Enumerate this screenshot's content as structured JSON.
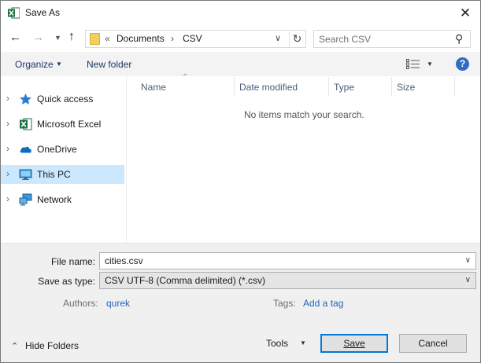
{
  "window": {
    "title": "Save As",
    "app_icon": "excel-icon"
  },
  "address": {
    "folder_icon": "folder-icon",
    "overflow": "«",
    "crumbs": [
      "Documents",
      "CSV"
    ],
    "separator": "›"
  },
  "search": {
    "placeholder": "Search CSV"
  },
  "toolbar": {
    "organize": "Organize",
    "new_folder": "New folder",
    "help": "?"
  },
  "nav": {
    "items": [
      {
        "label": "Quick access",
        "icon": "star-icon"
      },
      {
        "label": "Microsoft Excel",
        "icon": "excel-icon"
      },
      {
        "label": "OneDrive",
        "icon": "cloud-icon"
      },
      {
        "label": "This PC",
        "icon": "computer-icon",
        "selected": true
      },
      {
        "label": "Network",
        "icon": "network-icon"
      }
    ]
  },
  "filelist": {
    "columns": [
      "Name",
      "Date modified",
      "Type",
      "Size"
    ],
    "empty_message": "No items match your search."
  },
  "form": {
    "file_name_label": "File name:",
    "file_name": "cities.csv",
    "save_type_label": "Save as type:",
    "save_type": "CSV UTF-8 (Comma delimited) (*.csv)",
    "authors_label": "Authors:",
    "authors": "qurek",
    "tags_label": "Tags:",
    "tags_link": "Add a tag"
  },
  "footer": {
    "hide_folders": "Hide Folders",
    "tools": "Tools",
    "save": "Save",
    "cancel": "Cancel"
  },
  "colors": {
    "accent": "#0078d7",
    "selected_nav": "#cce8ff",
    "excel_green": "#1e7145",
    "link": "#1f66b8"
  }
}
